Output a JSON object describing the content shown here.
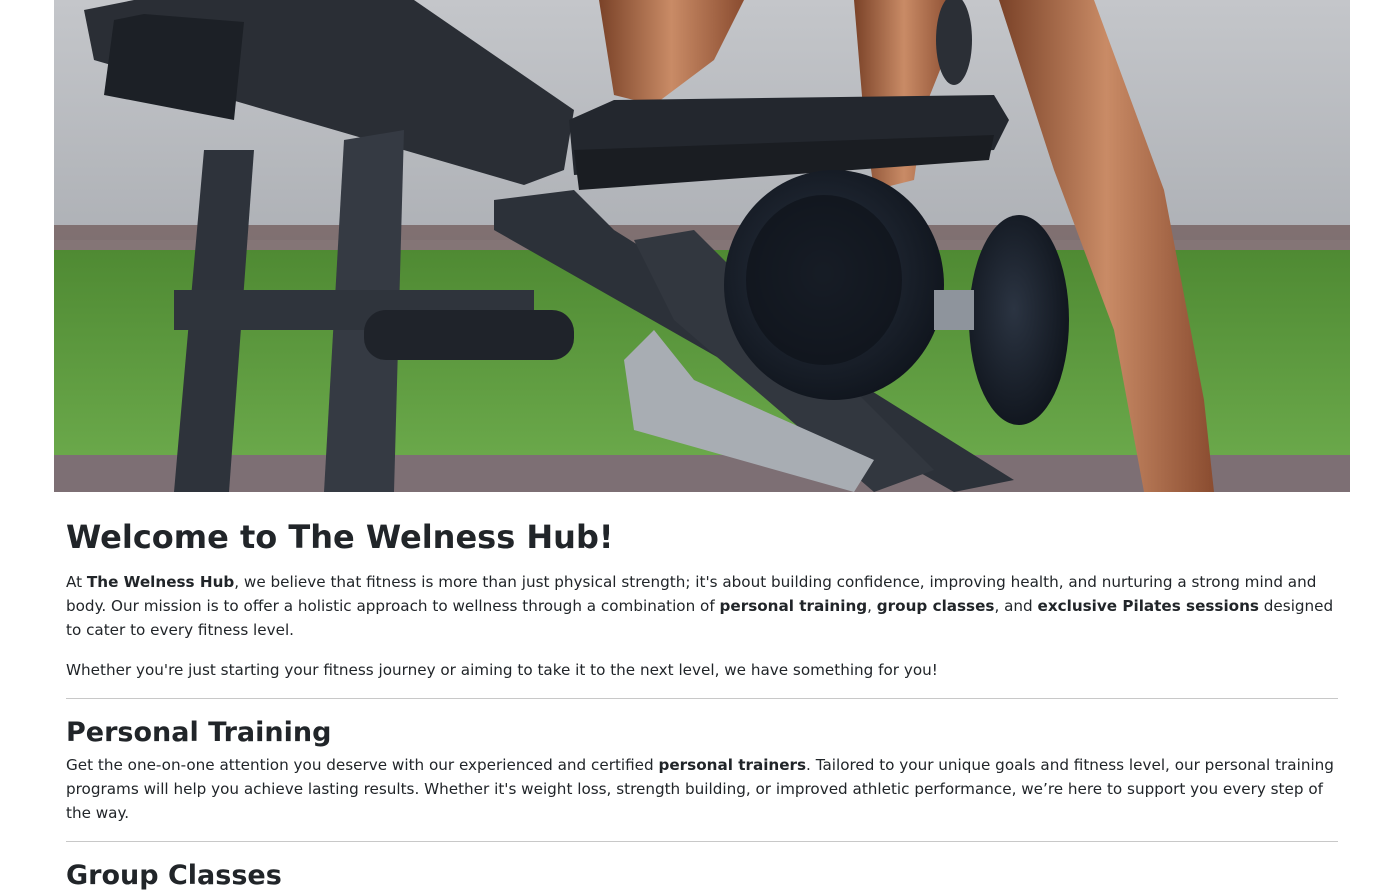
{
  "hero": {
    "image_description_icon": "gym-bench-dumbbell-image"
  },
  "welcome": {
    "title": "Welcome to The Welness Hub!",
    "intro": {
      "t1": "At ",
      "b1": "The Welness Hub",
      "t2": ", we believe that fitness is more than just physical strength; it's about building confidence, improving health, and nurturing a strong mind and body. Our mission is to offer a holistic approach to wellness through a combination of ",
      "b2": "personal training",
      "t3": ", ",
      "b3": "group classes",
      "t4": ", and ",
      "b4": "exclusive Pilates sessions",
      "t5": " designed to cater to every fitness level."
    },
    "tagline": "Whether you're just starting your fitness journey or aiming to take it to the next level, we have something for you!"
  },
  "personal_training": {
    "title": "Personal Training",
    "text": {
      "t1": "Get the one-on-one attention you deserve with our experienced and certified ",
      "b1": "personal trainers",
      "t2": ". Tailored to your unique goals and fitness level, our personal training programs will help you achieve lasting results. Whether it's weight loss, strength building, or improved athletic performance, we’re here to support you every step of the way."
    }
  },
  "group_classes": {
    "title": "Group Classes"
  },
  "colors": {
    "text": "#212529",
    "divider": "#c8c8c8",
    "floor_green": "#5e9a3e",
    "wall_gray": "#b9bcc1"
  }
}
